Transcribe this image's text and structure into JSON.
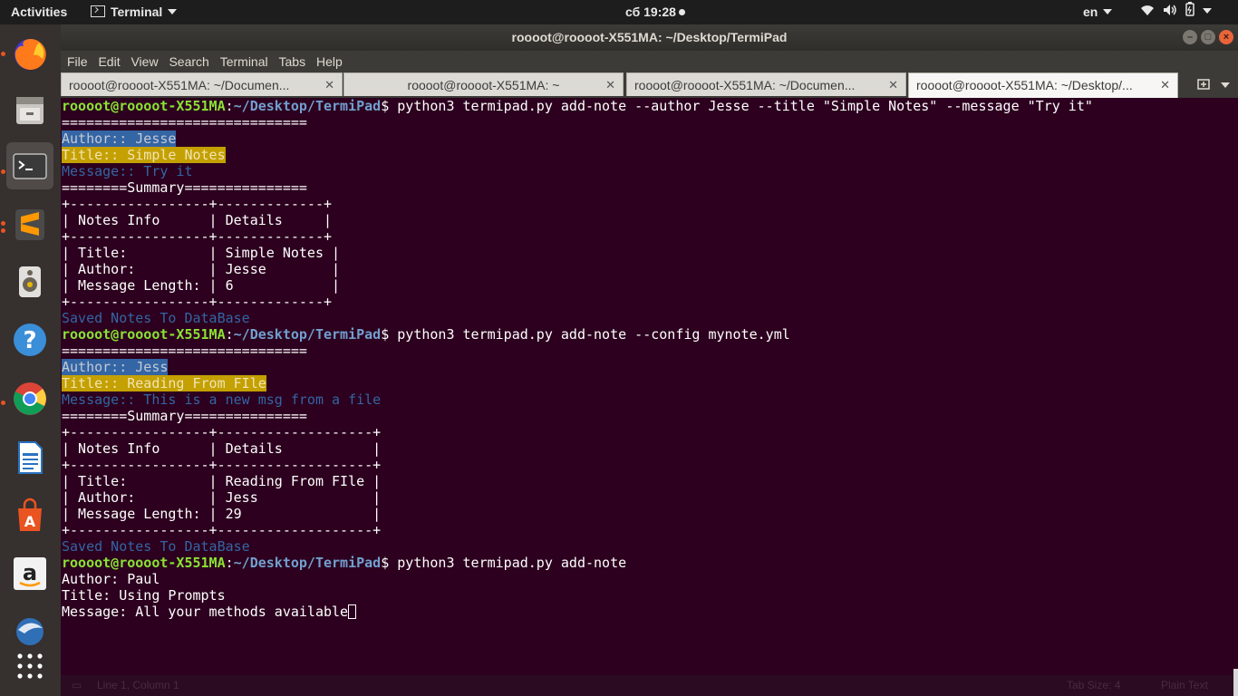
{
  "topbar": {
    "activities": "Activities",
    "app_name": "Terminal",
    "clock": "сб 19:28",
    "language": "en",
    "icons": [
      "wifi-icon",
      "volume-icon",
      "battery-icon",
      "power-menu-icon"
    ]
  },
  "dock": {
    "apps": [
      "firefox",
      "files",
      "terminal",
      "sublime-text",
      "rhythmbox",
      "help",
      "chrome",
      "libreoffice-writer",
      "ubuntu-software",
      "amazon",
      "thunderbird",
      "show-applications"
    ]
  },
  "window": {
    "title": "roooot@roooot-X551MA: ~/Desktop/TermiPad",
    "menu": [
      "File",
      "Edit",
      "View",
      "Search",
      "Terminal",
      "Tabs",
      "Help"
    ],
    "tabs": [
      {
        "label": "roooot@roooot-X551MA: ~/Documen..."
      },
      {
        "label": "roooot@roooot-X551MA: ~"
      },
      {
        "label": "roooot@roooot-X551MA: ~/Documen..."
      },
      {
        "label": "roooot@roooot-X551MA: ~/Desktop/..."
      }
    ]
  },
  "terminal": {
    "prompt_user": "roooot@roooot-X551MA",
    "prompt_sep": ":",
    "prompt_path": "~/Desktop/TermiPad",
    "prompt_end": "$ ",
    "cmd1": "python3 termipad.py add-note --author Jesse --title \"Simple Notes\" --message \"Try it\"",
    "sep_line": "==============================",
    "block1": {
      "author": "Author:: Jesse",
      "title": "Title:: Simple Notes",
      "message": "Message:: Try it",
      "summary": "========Summary===============",
      "table": [
        "+-----------------+-------------+",
        "| Notes Info      | Details     |",
        "+-----------------+-------------+",
        "| Title:          | Simple Notes |",
        "| Author:         | Jesse        |",
        "| Message Length: | 6            |",
        "+-----------------+-------------+"
      ],
      "saved": "Saved Notes To DataBase"
    },
    "cmd2": "python3 termipad.py add-note --config mynote.yml",
    "block2": {
      "author": "Author:: Jess",
      "title": "Title:: Reading From FIle",
      "message": "Message:: This is a new msg from a file",
      "summary": "========Summary===============",
      "table": [
        "+-----------------+-------------------+",
        "| Notes Info      | Details           |",
        "+-----------------+-------------------+",
        "| Title:          | Reading From FIle |",
        "| Author:         | Jess              |",
        "| Message Length: | 29                |",
        "+-----------------+-------------------+"
      ],
      "saved": "Saved Notes To DataBase"
    },
    "cmd3": "python3 termipad.py add-note",
    "prompts": {
      "author": "Author: Paul",
      "title": "Title: Using Prompts",
      "message": "Message: All your methods available"
    }
  },
  "statusbar": {
    "position": "Line 1, Column 1",
    "tab_size": "Tab Size: 4",
    "syntax": "Plain Text"
  }
}
